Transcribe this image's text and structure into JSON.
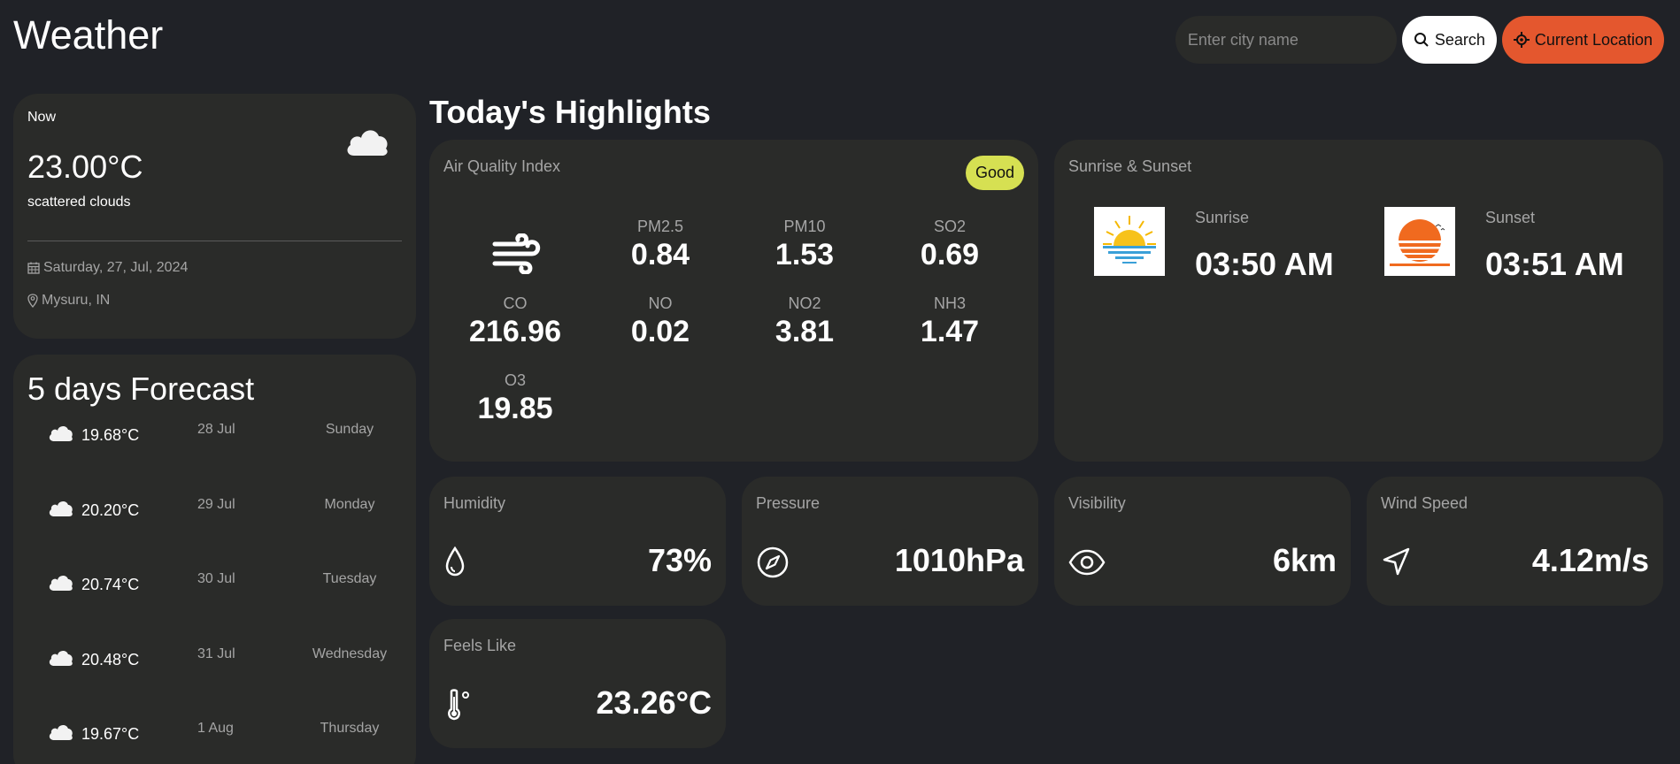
{
  "header": {
    "title": "Weather",
    "search_placeholder": "Enter city name",
    "search_label": "Search",
    "location_label": "Current Location"
  },
  "now": {
    "label": "Now",
    "temperature": "23.00°C",
    "description": "scattered clouds",
    "date": "Saturday, 27, Jul, 2024",
    "location": "Mysuru, IN"
  },
  "forecast": {
    "title": "5 days Forecast",
    "days": [
      {
        "temp": "19.68°C",
        "date": "28 Jul",
        "day": "Sunday"
      },
      {
        "temp": "20.20°C",
        "date": "29 Jul",
        "day": "Monday"
      },
      {
        "temp": "20.74°C",
        "date": "30 Jul",
        "day": "Tuesday"
      },
      {
        "temp": "20.48°C",
        "date": "31 Jul",
        "day": "Wednesday"
      },
      {
        "temp": "19.67°C",
        "date": "1 Aug",
        "day": "Thursday"
      }
    ]
  },
  "highlights": {
    "title": "Today's Highlights",
    "aqi": {
      "label": "Air Quality Index",
      "badge": "Good",
      "badge_color": "#d6e052",
      "pollutants": [
        {
          "name": "PM2.5",
          "value": "0.84"
        },
        {
          "name": "PM10",
          "value": "1.53"
        },
        {
          "name": "SO2",
          "value": "0.69"
        },
        {
          "name": "CO",
          "value": "216.96"
        },
        {
          "name": "NO",
          "value": "0.02"
        },
        {
          "name": "NO2",
          "value": "3.81"
        },
        {
          "name": "NH3",
          "value": "1.47"
        },
        {
          "name": "O3",
          "value": "19.85"
        }
      ]
    },
    "sun": {
      "label": "Sunrise & Sunset",
      "sunrise_label": "Sunrise",
      "sunrise_time": "03:50 AM",
      "sunset_label": "Sunset",
      "sunset_time": "03:51 AM"
    },
    "humidity": {
      "label": "Humidity",
      "value": "73%"
    },
    "pressure": {
      "label": "Pressure",
      "value": "1010hPa"
    },
    "visibility": {
      "label": "Visibility",
      "value": "6km"
    },
    "wind_speed": {
      "label": "Wind Speed",
      "value": "4.12m/s"
    },
    "feels_like": {
      "label": "Feels Like",
      "value": "23.26°C"
    }
  },
  "colors": {
    "background": "#202227",
    "card": "#2a2b29",
    "accent": "#e4572e",
    "muted_text": "#a5a5a5"
  }
}
